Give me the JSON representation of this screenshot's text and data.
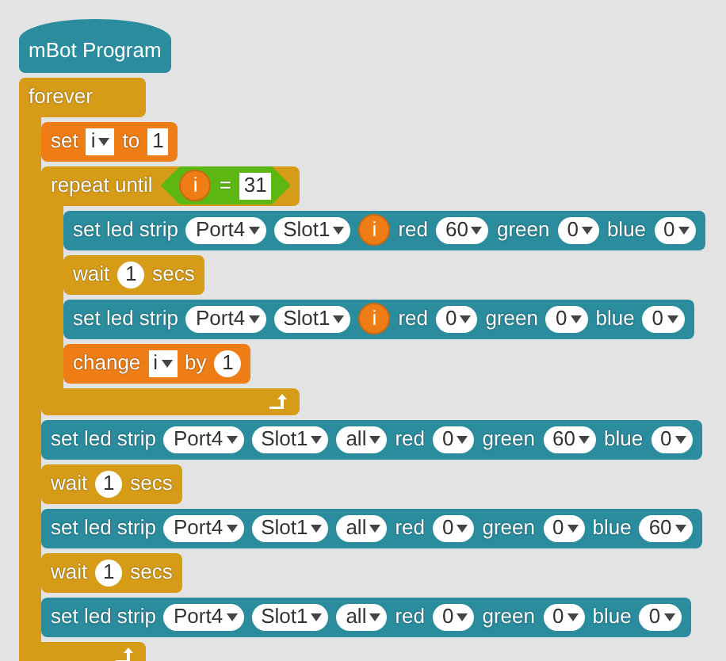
{
  "script": {
    "hat": {
      "label": "mBot Program"
    },
    "blocks": [
      {
        "kind": "c-block",
        "color": "#d69c17",
        "parts": [
          {
            "kind": "label",
            "text": "forever"
          }
        ],
        "children": [
          {
            "kind": "command",
            "color": "#ee7d16",
            "parts": [
              {
                "kind": "label",
                "text": "set"
              },
              {
                "kind": "dropdown-square",
                "text": "i"
              },
              {
                "kind": "label",
                "text": "to"
              },
              {
                "kind": "text-input",
                "text": "1"
              }
            ]
          },
          {
            "kind": "c-block",
            "color": "#d69c17",
            "parts": [
              {
                "kind": "label",
                "text": "repeat until"
              },
              {
                "kind": "condition",
                "parts": [
                  {
                    "kind": "reporter",
                    "text": "i"
                  },
                  {
                    "kind": "label",
                    "text": "="
                  },
                  {
                    "kind": "text-input",
                    "text": "31"
                  }
                ]
              }
            ],
            "children": [
              {
                "kind": "command",
                "color": "#2a8c9d",
                "parts": [
                  {
                    "kind": "label",
                    "text": "set led strip"
                  },
                  {
                    "kind": "dropdown",
                    "text": "Port4"
                  },
                  {
                    "kind": "dropdown",
                    "text": "Slot1"
                  },
                  {
                    "kind": "reporter",
                    "text": "i"
                  },
                  {
                    "kind": "label",
                    "text": "red"
                  },
                  {
                    "kind": "dropdown",
                    "text": "60"
                  },
                  {
                    "kind": "label",
                    "text": "green"
                  },
                  {
                    "kind": "dropdown",
                    "text": "0"
                  },
                  {
                    "kind": "label",
                    "text": "blue"
                  },
                  {
                    "kind": "dropdown",
                    "text": "0"
                  }
                ]
              },
              {
                "kind": "command",
                "color": "#d69c17",
                "parts": [
                  {
                    "kind": "label",
                    "text": "wait"
                  },
                  {
                    "kind": "number",
                    "text": "1"
                  },
                  {
                    "kind": "label",
                    "text": "secs"
                  }
                ]
              },
              {
                "kind": "command",
                "color": "#2a8c9d",
                "parts": [
                  {
                    "kind": "label",
                    "text": "set led strip"
                  },
                  {
                    "kind": "dropdown",
                    "text": "Port4"
                  },
                  {
                    "kind": "dropdown",
                    "text": "Slot1"
                  },
                  {
                    "kind": "reporter",
                    "text": "i"
                  },
                  {
                    "kind": "label",
                    "text": "red"
                  },
                  {
                    "kind": "dropdown",
                    "text": "0"
                  },
                  {
                    "kind": "label",
                    "text": "green"
                  },
                  {
                    "kind": "dropdown",
                    "text": "0"
                  },
                  {
                    "kind": "label",
                    "text": "blue"
                  },
                  {
                    "kind": "dropdown",
                    "text": "0"
                  }
                ]
              },
              {
                "kind": "command",
                "color": "#ee7d16",
                "parts": [
                  {
                    "kind": "label",
                    "text": "change"
                  },
                  {
                    "kind": "dropdown-square",
                    "text": "i"
                  },
                  {
                    "kind": "label",
                    "text": "by"
                  },
                  {
                    "kind": "number",
                    "text": "1"
                  }
                ]
              }
            ]
          },
          {
            "kind": "command",
            "color": "#2a8c9d",
            "parts": [
              {
                "kind": "label",
                "text": "set led strip"
              },
              {
                "kind": "dropdown",
                "text": "Port4"
              },
              {
                "kind": "dropdown",
                "text": "Slot1"
              },
              {
                "kind": "dropdown",
                "text": "all"
              },
              {
                "kind": "label",
                "text": "red"
              },
              {
                "kind": "dropdown",
                "text": "0"
              },
              {
                "kind": "label",
                "text": "green"
              },
              {
                "kind": "dropdown",
                "text": "60"
              },
              {
                "kind": "label",
                "text": "blue"
              },
              {
                "kind": "dropdown",
                "text": "0"
              }
            ]
          },
          {
            "kind": "command",
            "color": "#d69c17",
            "parts": [
              {
                "kind": "label",
                "text": "wait"
              },
              {
                "kind": "number",
                "text": "1"
              },
              {
                "kind": "label",
                "text": "secs"
              }
            ]
          },
          {
            "kind": "command",
            "color": "#2a8c9d",
            "parts": [
              {
                "kind": "label",
                "text": "set led strip"
              },
              {
                "kind": "dropdown",
                "text": "Port4"
              },
              {
                "kind": "dropdown",
                "text": "Slot1"
              },
              {
                "kind": "dropdown",
                "text": "all"
              },
              {
                "kind": "label",
                "text": "red"
              },
              {
                "kind": "dropdown",
                "text": "0"
              },
              {
                "kind": "label",
                "text": "green"
              },
              {
                "kind": "dropdown",
                "text": "0"
              },
              {
                "kind": "label",
                "text": "blue"
              },
              {
                "kind": "dropdown",
                "text": "60"
              }
            ]
          },
          {
            "kind": "command",
            "color": "#d69c17",
            "parts": [
              {
                "kind": "label",
                "text": "wait"
              },
              {
                "kind": "number",
                "text": "1"
              },
              {
                "kind": "label",
                "text": "secs"
              }
            ]
          },
          {
            "kind": "command",
            "color": "#2a8c9d",
            "parts": [
              {
                "kind": "label",
                "text": "set led strip"
              },
              {
                "kind": "dropdown",
                "text": "Port4"
              },
              {
                "kind": "dropdown",
                "text": "Slot1"
              },
              {
                "kind": "dropdown",
                "text": "all"
              },
              {
                "kind": "label",
                "text": "red"
              },
              {
                "kind": "dropdown",
                "text": "0"
              },
              {
                "kind": "label",
                "text": "green"
              },
              {
                "kind": "dropdown",
                "text": "0"
              },
              {
                "kind": "label",
                "text": "blue"
              },
              {
                "kind": "dropdown",
                "text": "0"
              }
            ]
          }
        ]
      }
    ]
  }
}
